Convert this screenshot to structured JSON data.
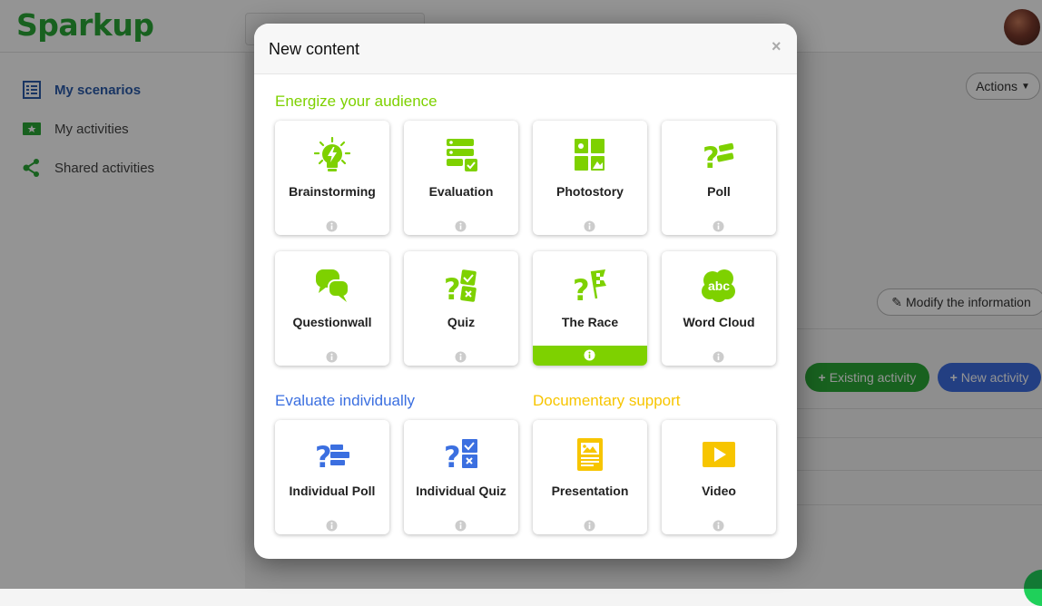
{
  "app": {
    "logo": "Sparkup"
  },
  "sidebar": {
    "items": [
      {
        "label": "My scenarios"
      },
      {
        "label": "My activities"
      },
      {
        "label": "Shared activities"
      }
    ]
  },
  "main": {
    "actions_label": "Actions",
    "modify_label": "Modify the information",
    "existing_activity_label": "Existing activity",
    "new_activity_label": "New activity"
  },
  "modal": {
    "title": "New content",
    "close_symbol": "×",
    "sections": [
      {
        "title": "Energize your audience",
        "color": "#7ed100",
        "cards": [
          {
            "label": "Brainstorming",
            "icon": "lightbulb-icon"
          },
          {
            "label": "Evaluation",
            "icon": "evaluation-icon"
          },
          {
            "label": "Photostory",
            "icon": "photostory-icon"
          },
          {
            "label": "Poll",
            "icon": "poll-icon"
          },
          {
            "label": "Questionwall",
            "icon": "speech-bubbles-icon"
          },
          {
            "label": "Quiz",
            "icon": "quiz-icon"
          },
          {
            "label": "The Race",
            "icon": "race-icon"
          },
          {
            "label": "Word Cloud",
            "icon": "word-cloud-icon"
          }
        ]
      },
      {
        "title": "Evaluate individually",
        "color": "#3b6fe0",
        "cards": [
          {
            "label": "Individual Poll",
            "icon": "individual-poll-icon"
          },
          {
            "label": "Individual Quiz",
            "icon": "individual-quiz-icon"
          }
        ]
      },
      {
        "title": "Documentary support",
        "color": "#f7c500",
        "cards": [
          {
            "label": "Presentation",
            "icon": "presentation-icon"
          },
          {
            "label": "Video",
            "icon": "video-icon"
          }
        ]
      }
    ],
    "word_cloud_text": "abc"
  }
}
